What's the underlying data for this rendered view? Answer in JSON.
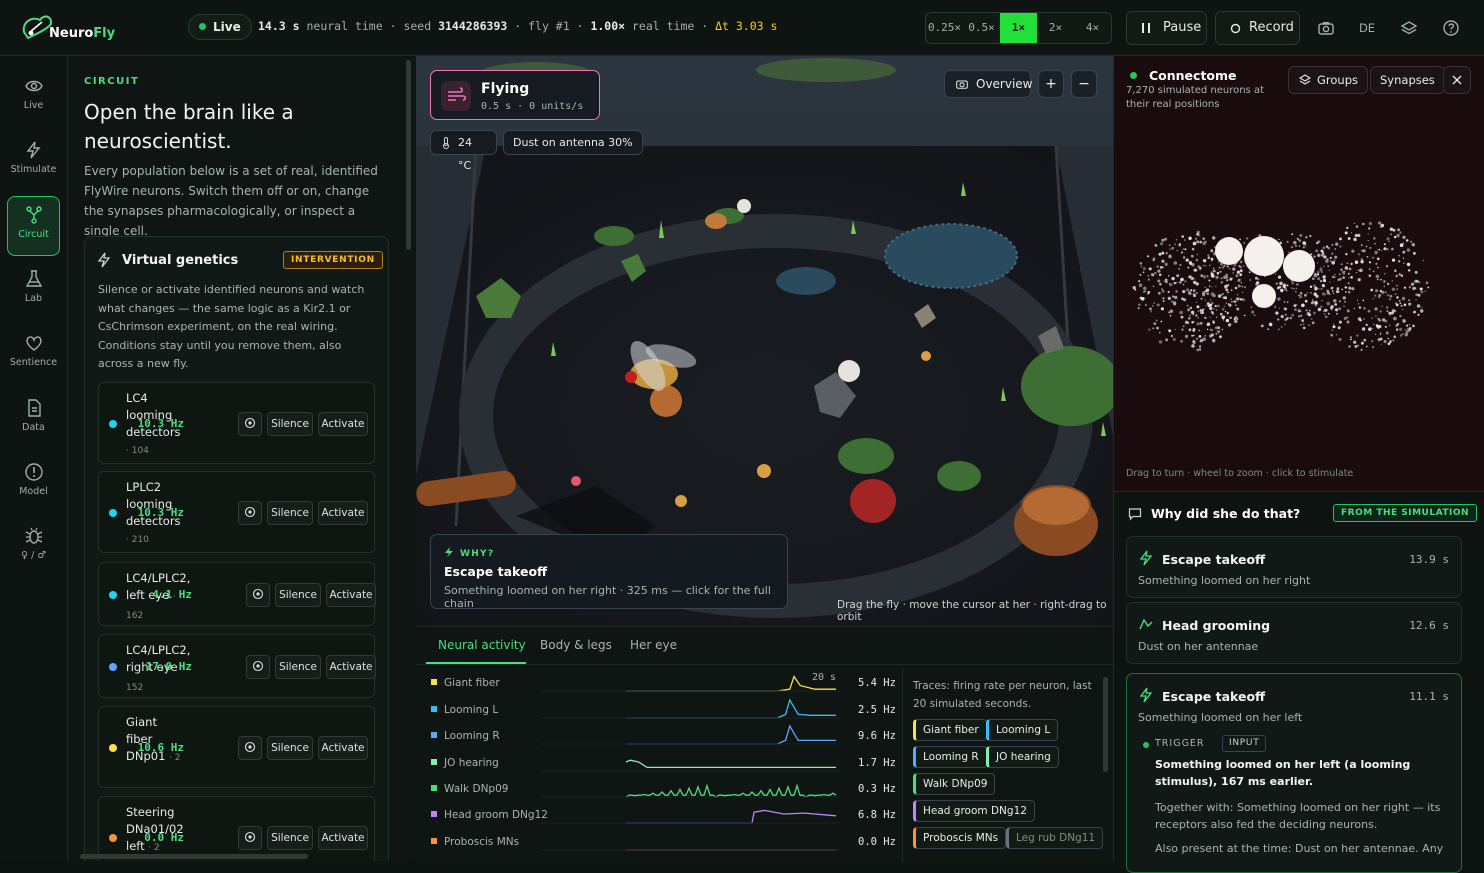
{
  "app": {
    "name_a": "Neuro",
    "name_b": "Fly"
  },
  "status": {
    "live_label": "Live",
    "neural_time_value": "14.3 s",
    "neural_time_label": "neural time",
    "seed_label": "seed",
    "seed_value": "3144286393",
    "fly_value": "fly #1",
    "speed_value": "1.00×",
    "speed_label": "real time",
    "dt_value": "Δt 3.03 s"
  },
  "speed_options": [
    "0.25×",
    "0.5×",
    "1×",
    "2×",
    "4×"
  ],
  "speed_selected": "1×",
  "toolbar": {
    "pause_label": "Pause",
    "record_label": "Record",
    "lang_label": "DE"
  },
  "nav": [
    {
      "label": "Live",
      "icon": "eye-icon"
    },
    {
      "label": "Stimulate",
      "icon": "bolt-icon"
    },
    {
      "label": "Circuit",
      "icon": "circuit-icon",
      "active": true
    },
    {
      "label": "Lab",
      "icon": "flask-icon"
    },
    {
      "label": "Sentience",
      "icon": "heart-icon"
    },
    {
      "label": "Data",
      "icon": "document-icon"
    },
    {
      "label": "Model",
      "icon": "info-icon"
    },
    {
      "label": "♀ / ♂",
      "icon": "bug-icon"
    }
  ],
  "circuit": {
    "kicker": "CIRCUIT",
    "title": "Open the brain like a neuroscientist.",
    "description": "Every population below is a set of real, identified FlyWire neurons. Switch them off or on, change the synapses pharmacologically, or inspect a single cell."
  },
  "virtual_genetics": {
    "title": "Virtual genetics",
    "badge": "INTERVENTION",
    "description": "Silence or activate identified neurons and watch what changes — the same logic as a Kir2.1 or CsChrimson experiment, on the real wiring. Conditions stay until you remove them, also across a new fly.",
    "silence_label": "Silence",
    "activate_label": "Activate",
    "populations": [
      {
        "name": "LC4 looming detectors",
        "count": "· 104",
        "hz": "10.3 Hz",
        "color": "#22d3ee"
      },
      {
        "name": "LPLC2 looming detectors",
        "count": "· 210",
        "hz": "10.3 Hz",
        "color": "#22d3ee"
      },
      {
        "name": "LC4/LPLC2, left eye",
        "count": "· 162",
        "hz": "4.1 Hz",
        "color": "#22d3ee"
      },
      {
        "name": "LC4/LPLC2, right eye",
        "count": "· 152",
        "hz": "17.0 Hz",
        "color": "#60a5fa"
      },
      {
        "name": "Giant fiber DNp01",
        "count": "· 2",
        "hz": "10.6 Hz",
        "color": "#fde047"
      },
      {
        "name": "Steering DNa01/02 left",
        "count": "· 2",
        "hz": "0.0 Hz",
        "color": "#fb923c"
      }
    ]
  },
  "viewport": {
    "behavior_title": "Flying",
    "behavior_sub": "0.5 s · 0 units/s",
    "temp_chip": "24 °C",
    "dust_chip": "Dust on antenna 30%",
    "overview_label": "Overview",
    "zoom_in": "+",
    "zoom_out": "−",
    "why_kicker": "WHY?",
    "why_title": "Escape takeoff",
    "why_desc": "Something loomed on her right · 325 ms — click for the full chain",
    "hint": "Drag the fly · move the cursor at her · right-drag to orbit"
  },
  "activity": {
    "tabs": [
      "Neural activity",
      "Body & legs",
      "Her eye"
    ],
    "window_label": "20 s",
    "traces": [
      {
        "name": "Giant fiber",
        "hz": "5.4 Hz",
        "color": "#fde047"
      },
      {
        "name": "Looming L",
        "hz": "2.5 Hz",
        "color": "#38bdf8"
      },
      {
        "name": "Looming R",
        "hz": "9.6 Hz",
        "color": "#60a5fa"
      },
      {
        "name": "JO hearing",
        "hz": "1.7 Hz",
        "color": "#86efac"
      },
      {
        "name": "Walk DNp09",
        "hz": "0.3 Hz",
        "color": "#4ade80"
      },
      {
        "name": "Head groom DNg12",
        "hz": "6.8 Hz",
        "color": "#c084fc"
      },
      {
        "name": "Proboscis MNs",
        "hz": "0.0 Hz",
        "color": "#fb923c"
      }
    ],
    "note": "Traces: firing rate per neuron, last 20 simulated seconds.",
    "chips": [
      {
        "label": "Giant fiber",
        "color": "#fde047"
      },
      {
        "label": "Looming L",
        "color": "#38bdf8"
      },
      {
        "label": "Looming R",
        "color": "#60a5fa"
      },
      {
        "label": "JO hearing",
        "color": "#86efac"
      },
      {
        "label": "Walk DNp09",
        "color": "#4ade80"
      },
      {
        "label": "Head groom DNg12",
        "color": "#c084fc"
      },
      {
        "label": "Proboscis MNs",
        "color": "#fb923c"
      },
      {
        "label": "Leg rub DNg11",
        "color": "#6b7280"
      }
    ]
  },
  "connectome": {
    "title": "Connectome",
    "subtitle": "7,270 simulated neurons at their real positions",
    "groups_label": "Groups",
    "synapses_label": "Synapses",
    "hint": "Drag to turn · wheel to zoom · click to stimulate"
  },
  "why_panel": {
    "title": "Why did she do that?",
    "badge": "FROM THE SIMULATION",
    "events": [
      {
        "title": "Escape takeoff",
        "time": "13.9 s",
        "desc": "Something loomed on her right"
      },
      {
        "title": "Head grooming",
        "time": "12.6 s",
        "desc": "Dust on her antennae"
      },
      {
        "title": "Escape takeoff",
        "time": "11.1 s",
        "desc": "Something loomed on her left"
      }
    ],
    "trigger_label": "TRIGGER",
    "trigger_badge": "INPUT",
    "trigger_text": "Something loomed on her left (a looming stimulus), 167 ms earlier.",
    "together_text": "Together with: Something loomed on her right — its receptors also fed the deciding neurons.",
    "also_text": "Also present at the time: Dust on her antennae. Any"
  },
  "colors": {
    "accent": "#22c55e",
    "speed_active": "#22e03a",
    "warning": "#fbbf24"
  }
}
